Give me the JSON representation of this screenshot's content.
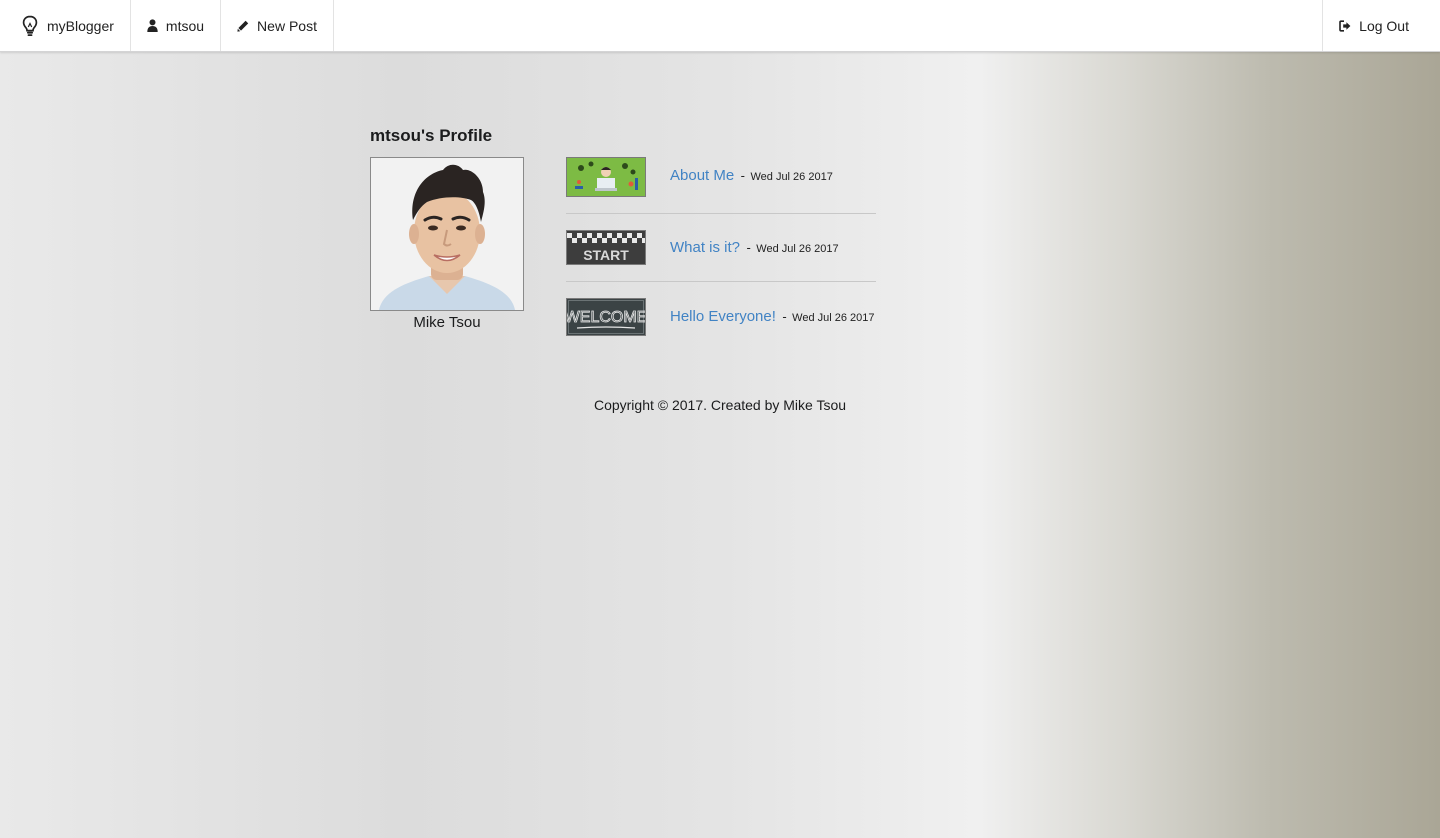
{
  "nav": {
    "brand": "myBlogger",
    "user": "mtsou",
    "new_post": "New Post",
    "logout": "Log Out"
  },
  "profile": {
    "title": "mtsou's Profile",
    "name": "Mike Tsou"
  },
  "posts": [
    {
      "title": "About Me",
      "separator": "-",
      "date": "Wed Jul 26 2017"
    },
    {
      "title": "What is it?",
      "separator": "-",
      "date": "Wed Jul 26 2017"
    },
    {
      "title": "Hello Everyone!",
      "separator": "-",
      "date": "Wed Jul 26 2017"
    }
  ],
  "footer": {
    "text": "Copyright © 2017. Created by Mike Tsou"
  },
  "icons": {
    "brand": "lightbulb-icon",
    "user": "user-icon",
    "new_post": "pencil-icon",
    "logout": "sign-out-icon"
  },
  "colors": {
    "link": "#4183c4",
    "navbar": "#ffffff"
  }
}
